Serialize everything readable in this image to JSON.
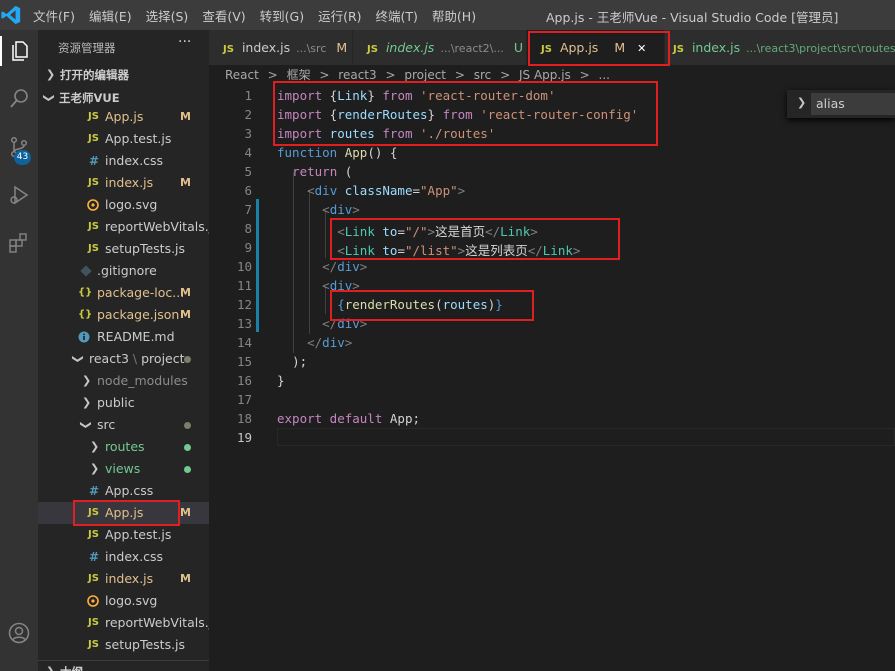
{
  "menu": [
    "文件(F)",
    "编辑(E)",
    "选择(S)",
    "查看(V)",
    "转到(G)",
    "运行(R)",
    "终端(T)",
    "帮助(H)"
  ],
  "window_title": "App.js - 王老师Vue - Visual Studio Code [管理员]",
  "activity": {
    "scm_badge": "43"
  },
  "sidebar": {
    "header": "资源管理器",
    "more": "···",
    "open_editors": "打开的编辑器",
    "workspace": "王老师VUE",
    "bottom_section": "大纲"
  },
  "files": [
    {
      "name": "App.js",
      "icon": "JS",
      "status": "M"
    },
    {
      "name": "App.test.js",
      "icon": "JS",
      "status": ""
    },
    {
      "name": "index.css",
      "icon": "#",
      "status": ""
    },
    {
      "name": "index.js",
      "icon": "JS",
      "status": "M"
    },
    {
      "name": "logo.svg",
      "icon": "svg",
      "status": ""
    },
    {
      "name": "reportWebVitals.js",
      "icon": "JS",
      "status": ""
    },
    {
      "name": "setupTests.js",
      "icon": "JS",
      "status": ""
    },
    {
      "name": ".gitignore",
      "icon": "git",
      "status": ""
    },
    {
      "name": "package-loc...",
      "icon": "{}",
      "status": "M"
    },
    {
      "name": "package.json",
      "icon": "{}",
      "status": "M"
    },
    {
      "name": "README.md",
      "icon": "i",
      "status": ""
    },
    {
      "name": "react3",
      "name2": "project",
      "icon": "",
      "status": "dot"
    },
    {
      "name": "node_modules",
      "icon": "",
      "status": ""
    },
    {
      "name": "public",
      "icon": "",
      "status": ""
    },
    {
      "name": "src",
      "icon": "",
      "status": "dot"
    },
    {
      "name": "routes",
      "icon": "",
      "status": "dot"
    },
    {
      "name": "views",
      "icon": "",
      "status": "dot"
    },
    {
      "name": "App.css",
      "icon": "#",
      "status": ""
    },
    {
      "name": "App.js",
      "icon": "JS",
      "status": "M"
    },
    {
      "name": "App.test.js",
      "icon": "JS",
      "status": ""
    },
    {
      "name": "index.css",
      "icon": "#",
      "status": ""
    },
    {
      "name": "index.js",
      "icon": "JS",
      "status": "M"
    },
    {
      "name": "logo.svg",
      "icon": "svg",
      "status": ""
    },
    {
      "name": "reportWebVitals.js",
      "icon": "JS",
      "status": ""
    },
    {
      "name": "setupTests.js",
      "icon": "JS",
      "status": ""
    }
  ],
  "tabs": [
    {
      "name": "index.js",
      "path": "...\\src",
      "status": "M"
    },
    {
      "name": "index.js",
      "path": "...\\react2\\...",
      "status": "U"
    },
    {
      "name": "App.js",
      "path": "",
      "status": "M",
      "close": "✕"
    },
    {
      "name": "index.js",
      "path": "...\\react3\\project\\src\\routes",
      "status": ""
    }
  ],
  "breadcrumbs": [
    "React",
    ">",
    "框架",
    ">",
    "react3",
    ">",
    "project",
    ">",
    "src",
    ">",
    "JS App.js",
    ">",
    "..."
  ],
  "find": {
    "value": "alias"
  },
  "line_numbers": [
    "1",
    "2",
    "3",
    "4",
    "5",
    "6",
    "7",
    "8",
    "9",
    "10",
    "11",
    "12",
    "13",
    "14",
    "15",
    "16",
    "17",
    "18",
    "19"
  ],
  "code": {
    "l1": {
      "kw": "import",
      "a": " {",
      "v": "Link",
      "b": "} ",
      "from": "from",
      "s": " 'react-router-dom'"
    },
    "l2": {
      "kw": "import",
      "a": " {",
      "v": "renderRoutes",
      "b": "} ",
      "from": "from",
      "s": " 'react-router-config'"
    },
    "l3": {
      "kw": "import",
      "v": " routes ",
      "from": "from",
      "s": " './routes'"
    },
    "l4": {
      "kw": "function",
      "fn": " App",
      "p": "() {"
    },
    "l5": {
      "kw": "return",
      "p": " ("
    },
    "l6": {
      "lt": "<",
      "tag": "div",
      "attr": " className",
      "eq": "=",
      "s": "\"App\"",
      "gt": ">"
    },
    "l7": {
      "lt": "<",
      "tag": "div",
      "gt": ">"
    },
    "l8": {
      "lt": "<",
      "tag": "Link",
      "attr": " to",
      "eq": "=",
      "s": "\"/\"",
      "gt": ">",
      "text": "这是首页",
      "close_lt": "</",
      "close_tag": "Link",
      "close_gt": ">"
    },
    "l9": {
      "lt": "<",
      "tag": "Link",
      "attr": " to",
      "eq": "=",
      "s": "\"/list\"",
      "gt": ">",
      "text": "这是列表页",
      "close_lt": "</",
      "close_tag": "Link",
      "close_gt": ">"
    },
    "l10": {
      "lt": "</",
      "tag": "div",
      "gt": ">"
    },
    "l11": {
      "lt": "<",
      "tag": "div",
      "gt": ">"
    },
    "l12": {
      "ob": "{",
      "fn": "renderRoutes",
      "op": "(",
      "v": "routes",
      "cp": ")",
      "cb": "}"
    },
    "l13": {
      "lt": "</",
      "tag": "div",
      "gt": ">"
    },
    "l14": {
      "lt": "</",
      "tag": "div",
      "gt": ">"
    },
    "l15": {
      "p": ");"
    },
    "l16": {
      "p": "}"
    },
    "l18": {
      "kw": "export",
      "kw2": " default",
      "p": " App;"
    }
  }
}
